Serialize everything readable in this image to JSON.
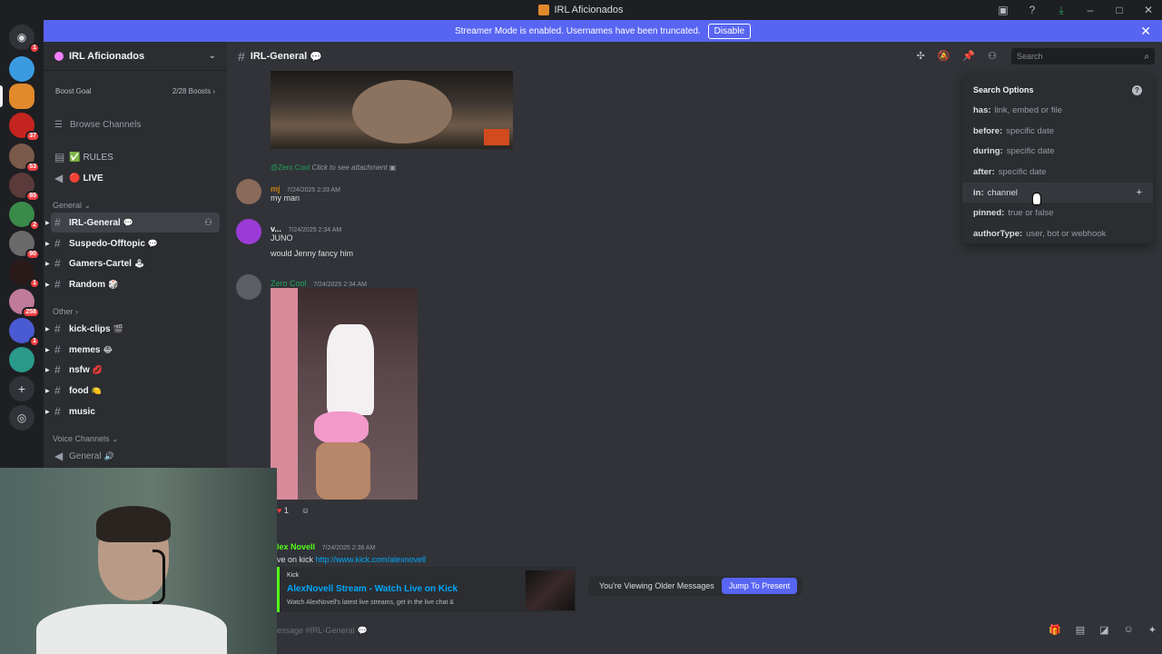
{
  "window": {
    "title": "IRL Aficionados"
  },
  "banner": {
    "text": "Streamer Mode is enabled. Usernames have been truncated.",
    "disable_label": "Disable"
  },
  "servers": [
    {
      "badge": "1"
    },
    {
      "badge": ""
    },
    {
      "badge": ""
    },
    {
      "badge": "37"
    },
    {
      "badge": "53"
    },
    {
      "badge": "85"
    },
    {
      "badge": "2"
    },
    {
      "badge": "90"
    },
    {
      "badge": "1"
    },
    {
      "badge": "258"
    },
    {
      "badge": "1"
    },
    {
      "badge": ""
    }
  ],
  "sidebar": {
    "guild_name": "IRL Aficionados",
    "boost_label": "Boost Goal",
    "boost_count": "2/28 Boosts",
    "browse_label": "Browse Channels",
    "channels_top": [
      {
        "name": "RULES",
        "icon": "✅"
      },
      {
        "name": "LIVE",
        "icon": "🔴"
      }
    ],
    "category_general": "General",
    "general_channels": [
      {
        "name": "IRL-General",
        "emoji": "💬"
      },
      {
        "name": "Suspedo-Offtopic",
        "emoji": "💬"
      },
      {
        "name": "Gamers-Cartel",
        "emoji": "🕹"
      },
      {
        "name": "Random",
        "emoji": "🎲"
      }
    ],
    "category_other": "Other",
    "other_channels": [
      {
        "name": "kick-clips",
        "emoji": "🎬"
      },
      {
        "name": "memes",
        "emoji": "😂"
      },
      {
        "name": "nsfw",
        "emoji": "💋"
      },
      {
        "name": "food",
        "emoji": "🍋"
      },
      {
        "name": "music",
        "emoji": ""
      }
    ],
    "category_voice": "Voice Channels",
    "voice_channel": "General"
  },
  "chat": {
    "channel_name": "IRL-General",
    "channel_emoji": "💬",
    "search_placeholder": "Search",
    "reply_ref": "@Zero Cool",
    "reply_text": "Click to see attachment",
    "messages": [
      {
        "user": "mj",
        "ts": "7/24/2025 2:33 AM",
        "text": "my man",
        "color": "#c27c0e"
      },
      {
        "user": "v...",
        "ts": "7/24/2025 2:34 AM",
        "text": "JUNO",
        "text2": "would Jenny fancy him",
        "color": "#f2f3f5"
      },
      {
        "user": "Zero Cool",
        "ts": "7/24/2025 2:34 AM",
        "color": "#23a55a"
      },
      {
        "user": "lex Novell",
        "ts": "7/24/2025 2:36 AM",
        "text": "ve on kick",
        "link": "http://www.kick.com/alexnovell",
        "color": "#53fc18"
      }
    ],
    "reaction_count": "1",
    "embed": {
      "provider": "Kick",
      "title": "AlexNovell Stream - Watch Live on Kick",
      "desc": "Watch AlexNovell's latest live streams, get in the live chat &"
    },
    "jump": {
      "text": "You're Viewing Older Messages",
      "button": "Jump To Present"
    },
    "composer_placeholder": "essage #IRL-General"
  },
  "search_options": {
    "title": "Search Options",
    "items": [
      {
        "key": "has:",
        "hint": "link, embed or file"
      },
      {
        "key": "before:",
        "hint": "specific date"
      },
      {
        "key": "during:",
        "hint": "specific date"
      },
      {
        "key": "after:",
        "hint": "specific date"
      },
      {
        "key": "in:",
        "hint": "channel"
      },
      {
        "key": "pinned:",
        "hint": "true or false"
      },
      {
        "key": "authorType:",
        "hint": "user, bot or webhook"
      }
    ]
  }
}
